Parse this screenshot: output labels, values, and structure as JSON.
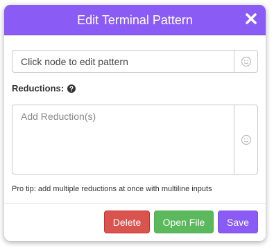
{
  "modal": {
    "title": "Edit Terminal Pattern",
    "header_color": "#8a5cf5"
  },
  "pattern_field": {
    "placeholder": "Click node to edit pattern",
    "value": "",
    "addon_icon": "smiley-icon"
  },
  "reductions": {
    "label": "Reductions:",
    "help_icon": "question-circle-icon",
    "placeholder": "Add Reduction(s)",
    "value": "",
    "addon_icon": "smiley-icon"
  },
  "pro_tip": "Pro tip: add multiple reductions at once with multiline inputs",
  "footer": {
    "delete_label": "Delete",
    "open_file_label": "Open File",
    "save_label": "Save",
    "delete_color": "#d9534f",
    "open_file_color": "#5cb85c",
    "save_color": "#8a5cf5"
  }
}
